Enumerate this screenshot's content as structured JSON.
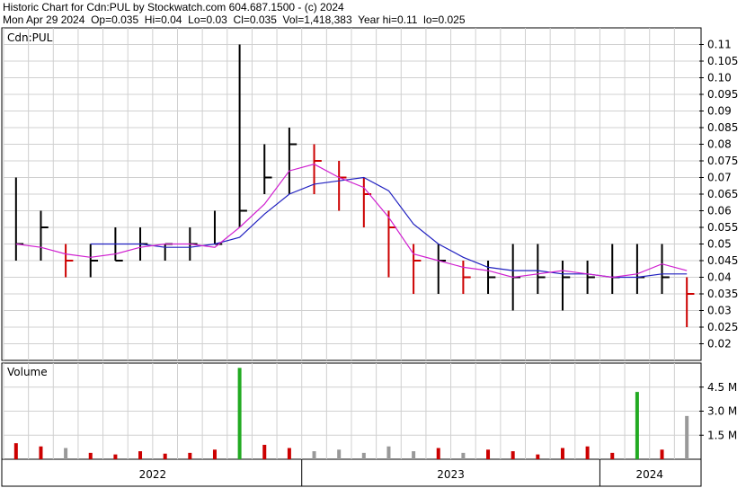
{
  "header": {
    "line1": "Historic Chart for Cdn:PUL by Stockwatch.com 604.687.1500 - (c) 2024",
    "line2": "Mon Apr 29 2024  Op=0.035  Hi=0.04  Lo=0.03  Cl=0.035  Vol=1,418,383  Year hi=0.11  lo=0.025"
  },
  "colors": {
    "up": "#000000",
    "down": "#cc0000",
    "ma_short": "#d020d0",
    "ma_long": "#2020c0",
    "vol_up": "#cc0000",
    "vol_down": "#999999",
    "vol_spike": "#22aa22",
    "grid": "#d0d0d0"
  },
  "chart_data": [
    {
      "type": "line",
      "panel": "price",
      "title": "Cdn:PUL",
      "ylim": [
        0.015,
        0.115
      ],
      "yticks": [
        "0.11",
        "0.105",
        "0.10",
        "0.095",
        "0.09",
        "0.085",
        "0.08",
        "0.075",
        "0.07",
        "0.065",
        "0.06",
        "0.055",
        "0.05",
        "0.045",
        "0.04",
        "0.035",
        "0.03",
        "0.025",
        "0.02"
      ],
      "x": [
        "2022-01",
        "2022-02",
        "2022-03",
        "2022-04",
        "2022-05",
        "2022-06",
        "2022-07",
        "2022-08",
        "2022-09",
        "2022-10",
        "2022-11",
        "2022-12",
        "2023-01",
        "2023-02",
        "2023-03",
        "2023-04",
        "2023-05",
        "2023-06",
        "2023-07",
        "2023-08",
        "2023-09",
        "2023-10",
        "2023-11",
        "2023-12",
        "2024-01",
        "2024-02",
        "2024-03",
        "2024-04"
      ],
      "series": [
        {
          "role": "price_close",
          "values": [
            0.05,
            0.055,
            0.045,
            0.045,
            0.045,
            0.05,
            0.05,
            0.05,
            0.05,
            0.06,
            0.07,
            0.08,
            0.075,
            0.07,
            0.065,
            0.055,
            0.045,
            0.045,
            0.04,
            0.04,
            0.04,
            0.04,
            0.04,
            0.04,
            0.04,
            0.04,
            0.04,
            0.035
          ]
        },
        {
          "role": "price_high",
          "values": [
            0.07,
            0.06,
            0.05,
            0.05,
            0.055,
            0.055,
            0.05,
            0.055,
            0.06,
            0.11,
            0.08,
            0.085,
            0.08,
            0.075,
            0.07,
            0.06,
            0.05,
            0.05,
            0.045,
            0.045,
            0.05,
            0.05,
            0.045,
            0.045,
            0.05,
            0.05,
            0.05,
            0.04
          ]
        },
        {
          "role": "price_low",
          "values": [
            0.045,
            0.045,
            0.04,
            0.04,
            0.045,
            0.045,
            0.045,
            0.045,
            0.05,
            0.055,
            0.065,
            0.065,
            0.065,
            0.06,
            0.055,
            0.04,
            0.035,
            0.035,
            0.035,
            0.035,
            0.03,
            0.035,
            0.03,
            0.035,
            0.035,
            0.035,
            0.035,
            0.025
          ]
        },
        {
          "role": "ma_short",
          "values": [
            0.05,
            0.049,
            0.047,
            0.046,
            0.047,
            0.049,
            0.05,
            0.05,
            0.049,
            0.055,
            0.062,
            0.072,
            0.074,
            0.07,
            0.067,
            0.058,
            0.047,
            0.045,
            0.043,
            0.042,
            0.04,
            0.041,
            0.042,
            0.041,
            0.04,
            0.041,
            0.044,
            0.042
          ]
        },
        {
          "role": "ma_long",
          "values": [
            null,
            null,
            null,
            0.05,
            0.05,
            0.05,
            0.049,
            0.049,
            0.05,
            0.052,
            0.059,
            0.065,
            0.068,
            0.069,
            0.07,
            0.066,
            0.056,
            0.05,
            0.046,
            0.043,
            0.042,
            0.042,
            0.041,
            0.041,
            0.04,
            0.04,
            0.041,
            0.041
          ]
        }
      ]
    },
    {
      "type": "bar",
      "panel": "volume",
      "title": "Volume",
      "ylim": [
        0,
        6000000
      ],
      "yticks": [
        "4.5 M",
        "3.0 M",
        "1.5 M"
      ],
      "x": [
        "2022-01",
        "2022-02",
        "2022-03",
        "2022-04",
        "2022-05",
        "2022-06",
        "2022-07",
        "2022-08",
        "2022-09",
        "2022-10",
        "2022-11",
        "2022-12",
        "2023-01",
        "2023-02",
        "2023-03",
        "2023-04",
        "2023-05",
        "2023-06",
        "2023-07",
        "2023-08",
        "2023-09",
        "2023-10",
        "2023-11",
        "2023-12",
        "2024-01",
        "2024-02",
        "2024-03",
        "2024-04"
      ],
      "values": [
        1000000,
        800000,
        700000,
        400000,
        300000,
        500000,
        350000,
        400000,
        600000,
        5700000,
        900000,
        700000,
        500000,
        600000,
        400000,
        800000,
        500000,
        700000,
        400000,
        600000,
        500000,
        300000,
        700000,
        800000,
        400000,
        4200000,
        600000,
        2700000
      ]
    }
  ],
  "x_axis": {
    "labels": [
      "2022",
      "2023",
      "2024"
    ]
  }
}
